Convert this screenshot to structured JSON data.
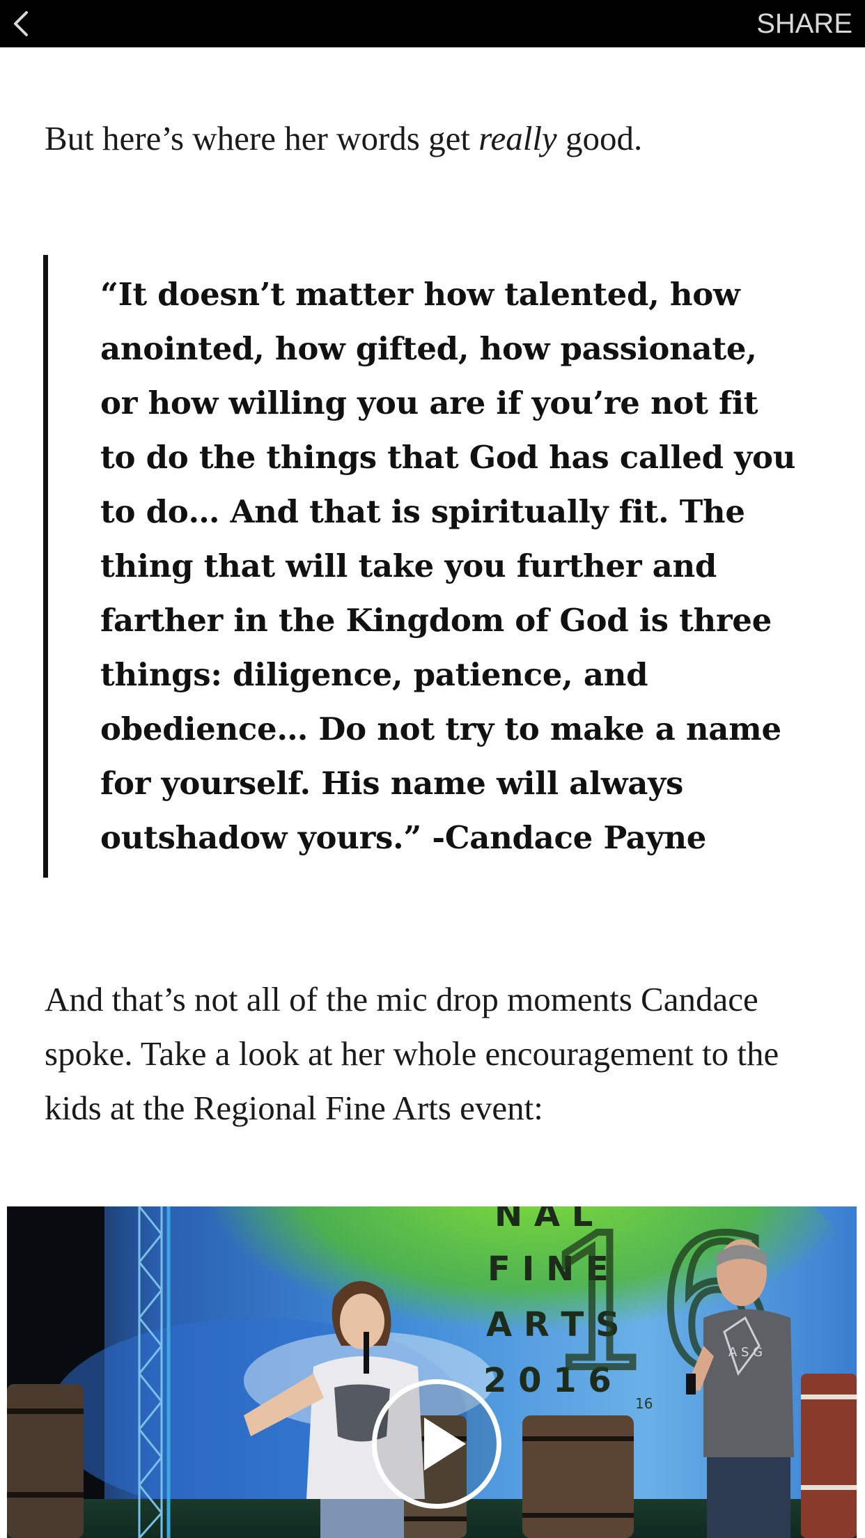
{
  "topbar": {
    "back_icon": "chevron-left-icon",
    "share_label": "SHARE"
  },
  "article": {
    "lead_before": "But here’s where her words get ",
    "lead_emphasis": "really",
    "lead_after": " good.",
    "quote": "“It doesn’t matter how talented, how anointed, how gifted, how passionate, or how willing you are if you’re not fit to do the things that God has called you to do… And that is spiritually fit. The thing that will take you further and farther in the Kingdom of God is three things: diligence, patience, and obedience… Do not try to make a name for yourself. His name will always outshadow yours.” -Candace Payne",
    "paragraph": "And that’s not all of the mic drop moments Candace spoke. Take a look at her whole encouragement to the kids at the Regional Fine Arts event:"
  },
  "video": {
    "play_icon": "play-icon",
    "sign_lines": [
      "N A L",
      "F I N E",
      "A R T S",
      "2 0 1 6"
    ],
    "sign_big_number": "16",
    "sign_small_text": "16",
    "shirt_text": "A S G"
  },
  "colors": {
    "topbar": "#000000",
    "share_text": "#d8d8d8",
    "body_text": "#1a1a1a",
    "quote_bar": "#111111"
  }
}
